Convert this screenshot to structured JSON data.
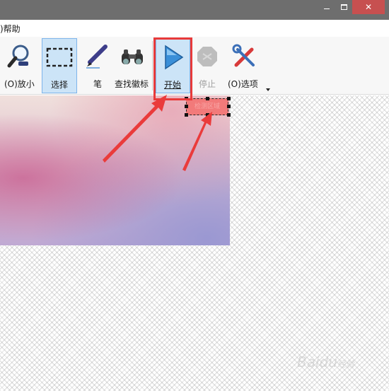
{
  "window": {
    "close_glyph": "✕"
  },
  "menu": {
    "help": ")帮助"
  },
  "toolbar": {
    "zoom_out": "(O)放小",
    "select": "选择",
    "pen": "笔",
    "find_icon": "查找徽标",
    "start": "开始",
    "stop": "停止",
    "options": "(O)选项"
  },
  "canvas": {
    "selection_text": "检测区域"
  },
  "watermark": {
    "text": "Baidu",
    "sub": "经验"
  },
  "colors": {
    "annotation_red": "#e83a3a",
    "selected_bg": "#cce4f7",
    "titlebar": "#6e6e6e"
  }
}
